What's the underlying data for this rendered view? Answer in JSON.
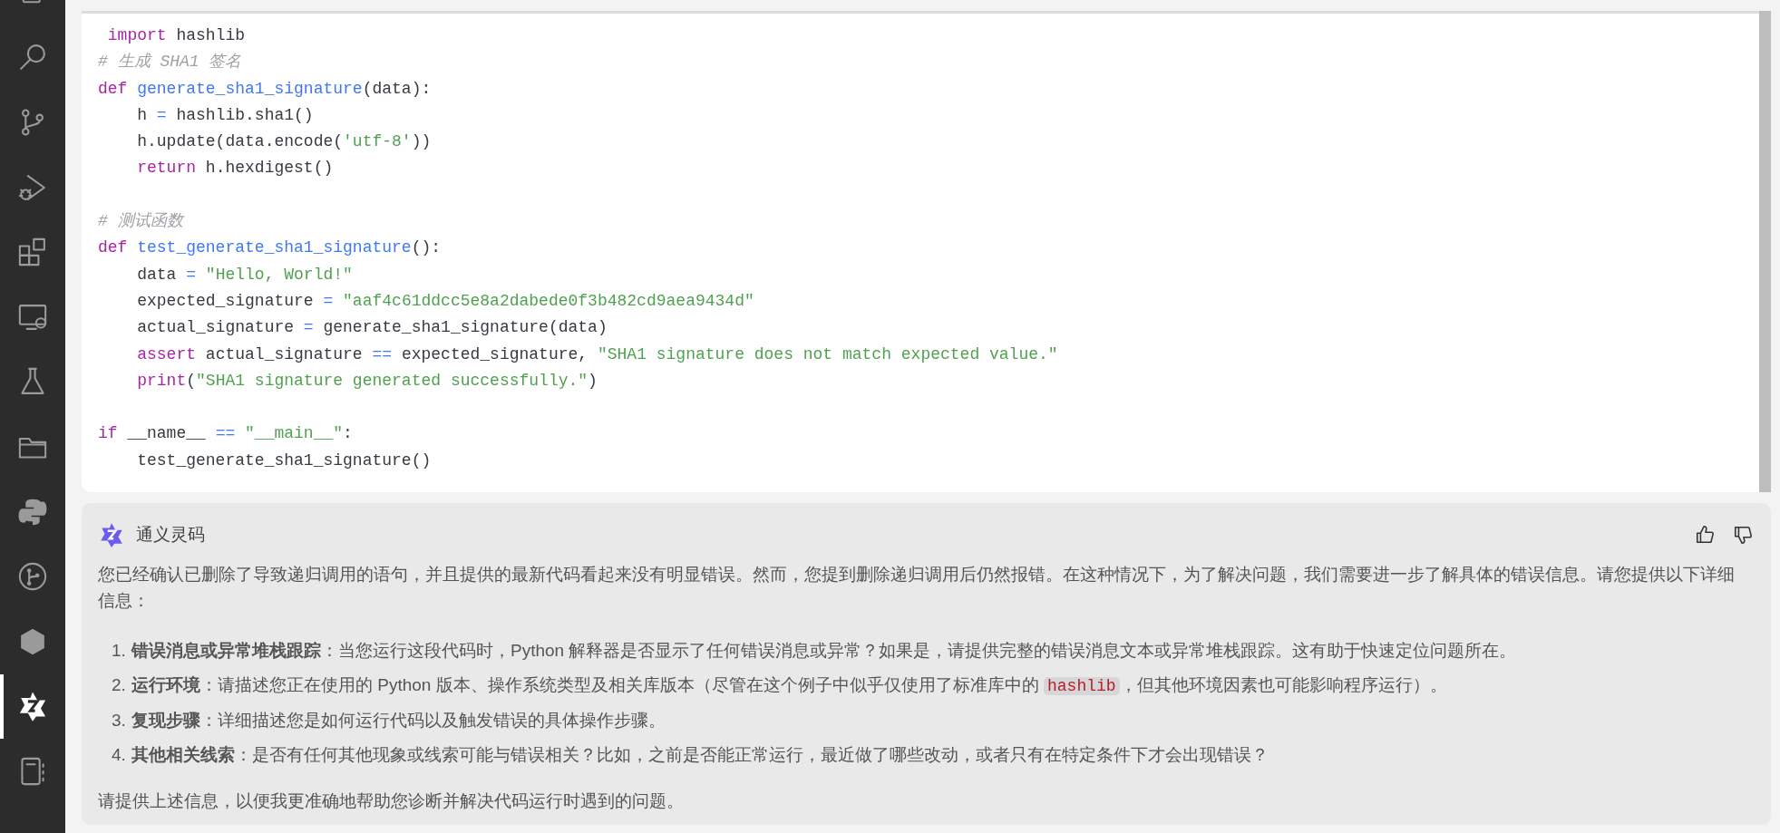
{
  "activity_bar": {
    "items": [
      {
        "selected": false
      },
      {
        "selected": false
      },
      {
        "selected": false
      },
      {
        "selected": false
      },
      {
        "selected": false
      },
      {
        "selected": false
      },
      {
        "selected": false
      },
      {
        "selected": false
      },
      {
        "selected": false
      },
      {
        "selected": false
      },
      {
        "selected": false
      },
      {
        "selected": true
      },
      {
        "selected": false
      }
    ]
  },
  "code_block": {
    "blocks": [
      [
        [
          {
            "kind": "keyword",
            "text": " import"
          },
          {
            "kind": "plain",
            "text": " hashlib"
          }
        ],
        [
          {
            "kind": "comment",
            "text": "# 生成 SHA1 签名"
          }
        ],
        [
          {
            "kind": "keyword",
            "text": "def"
          },
          {
            "kind": "function",
            "text": " generate_sha1_signature"
          },
          {
            "kind": "plain",
            "text": "(data):"
          }
        ],
        [
          {
            "kind": "plain",
            "text": "    h "
          },
          {
            "kind": "operator",
            "text": "="
          },
          {
            "kind": "plain",
            "text": " hashlib.sha1()"
          }
        ],
        [
          {
            "kind": "plain",
            "text": "    h.update(data.encode("
          },
          {
            "kind": "string",
            "text": "'utf-8'"
          },
          {
            "kind": "plain",
            "text": "))"
          }
        ],
        [
          {
            "kind": "keyword",
            "text": "    return"
          },
          {
            "kind": "plain",
            "text": " h.hexdigest()"
          }
        ]
      ],
      [
        [
          {
            "kind": "comment",
            "text": "# 测试函数"
          }
        ],
        [
          {
            "kind": "keyword",
            "text": "def"
          },
          {
            "kind": "function",
            "text": " test_generate_sha1_signature"
          },
          {
            "kind": "plain",
            "text": "():"
          }
        ],
        [
          {
            "kind": "plain",
            "text": "    data "
          },
          {
            "kind": "operator",
            "text": "="
          },
          {
            "kind": "string",
            "text": " \"Hello, World!\""
          }
        ],
        [
          {
            "kind": "plain",
            "text": "    expected_signature "
          },
          {
            "kind": "operator",
            "text": "="
          },
          {
            "kind": "string",
            "text": " \"aaf4c61ddcc5e8a2dabede0f3b482cd9aea9434d\""
          }
        ],
        [
          {
            "kind": "plain",
            "text": "    actual_signature "
          },
          {
            "kind": "operator",
            "text": "="
          },
          {
            "kind": "plain",
            "text": " generate_sha1_signature(data)"
          }
        ],
        [
          {
            "kind": "keyword",
            "text": "    assert"
          },
          {
            "kind": "plain",
            "text": " actual_signature "
          },
          {
            "kind": "operator",
            "text": "=="
          },
          {
            "kind": "plain",
            "text": " expected_signature, "
          },
          {
            "kind": "string",
            "text": "\"SHA1 signature does not match expected value.\""
          }
        ],
        [
          {
            "kind": "keyword",
            "text": "    print"
          },
          {
            "kind": "plain",
            "text": "("
          },
          {
            "kind": "string",
            "text": "\"SHA1 signature generated successfully.\""
          },
          {
            "kind": "plain",
            "text": ")"
          }
        ]
      ],
      [
        [
          {
            "kind": "keyword",
            "text": "if"
          },
          {
            "kind": "plain",
            "text": " __name__ "
          },
          {
            "kind": "operator",
            "text": "=="
          },
          {
            "kind": "string",
            "text": " \"__main__\""
          },
          {
            "kind": "plain",
            "text": ":"
          }
        ],
        [
          {
            "kind": "plain",
            "text": "    test_generate_sha1_signature()"
          }
        ]
      ]
    ]
  },
  "message": {
    "author": "通义灵码",
    "intro": "您已经确认已删除了导致递归调用的语句，并且提供的最新代码看起来没有明显错误。然而，您提到删除递归调用后仍然报错。在这种情况下，为了解决问题，我们需要进一步了解具体的错误信息。请您提供以下详细信息：",
    "list": [
      {
        "number": "1.",
        "parts": [
          {
            "kind": "text",
            "text": "**错误消息或异常堆栈跟踪**：当您运行这段代码时，Python 解释器是否显示了任何错误消息或异常？如果是，请提供完整的错误消息文本或异常堆栈跟踪。这有助于快速定位问题所在。"
          }
        ]
      },
      {
        "number": "2.",
        "parts": [
          {
            "kind": "text",
            "text": "**运行环境**：请描述您正在使用的 Python 版本、操作系统类型及相关库版本（尽管在这个例子中似乎仅使用了标准库中的 "
          },
          {
            "kind": "code",
            "text": "hashlib"
          },
          {
            "kind": "text",
            "text": "，但其他环境因素也可能影响程序运行）。"
          }
        ]
      },
      {
        "number": "3.",
        "parts": [
          {
            "kind": "text",
            "text": "**复现步骤**：详细描述您是如何运行代码以及触发错误的具体操作步骤。"
          }
        ]
      },
      {
        "number": "4.",
        "parts": [
          {
            "kind": "text",
            "text": "**其他相关线索**：是否有任何其他现象或线索可能与错误相关？比如，之前是否能正常运行，最近做了哪些改动，或者只有在特定条件下才会出现错误？"
          }
        ]
      }
    ],
    "closing": "请提供上述信息，以便我更准确地帮助您诊断并解决代码运行时遇到的问题。"
  }
}
